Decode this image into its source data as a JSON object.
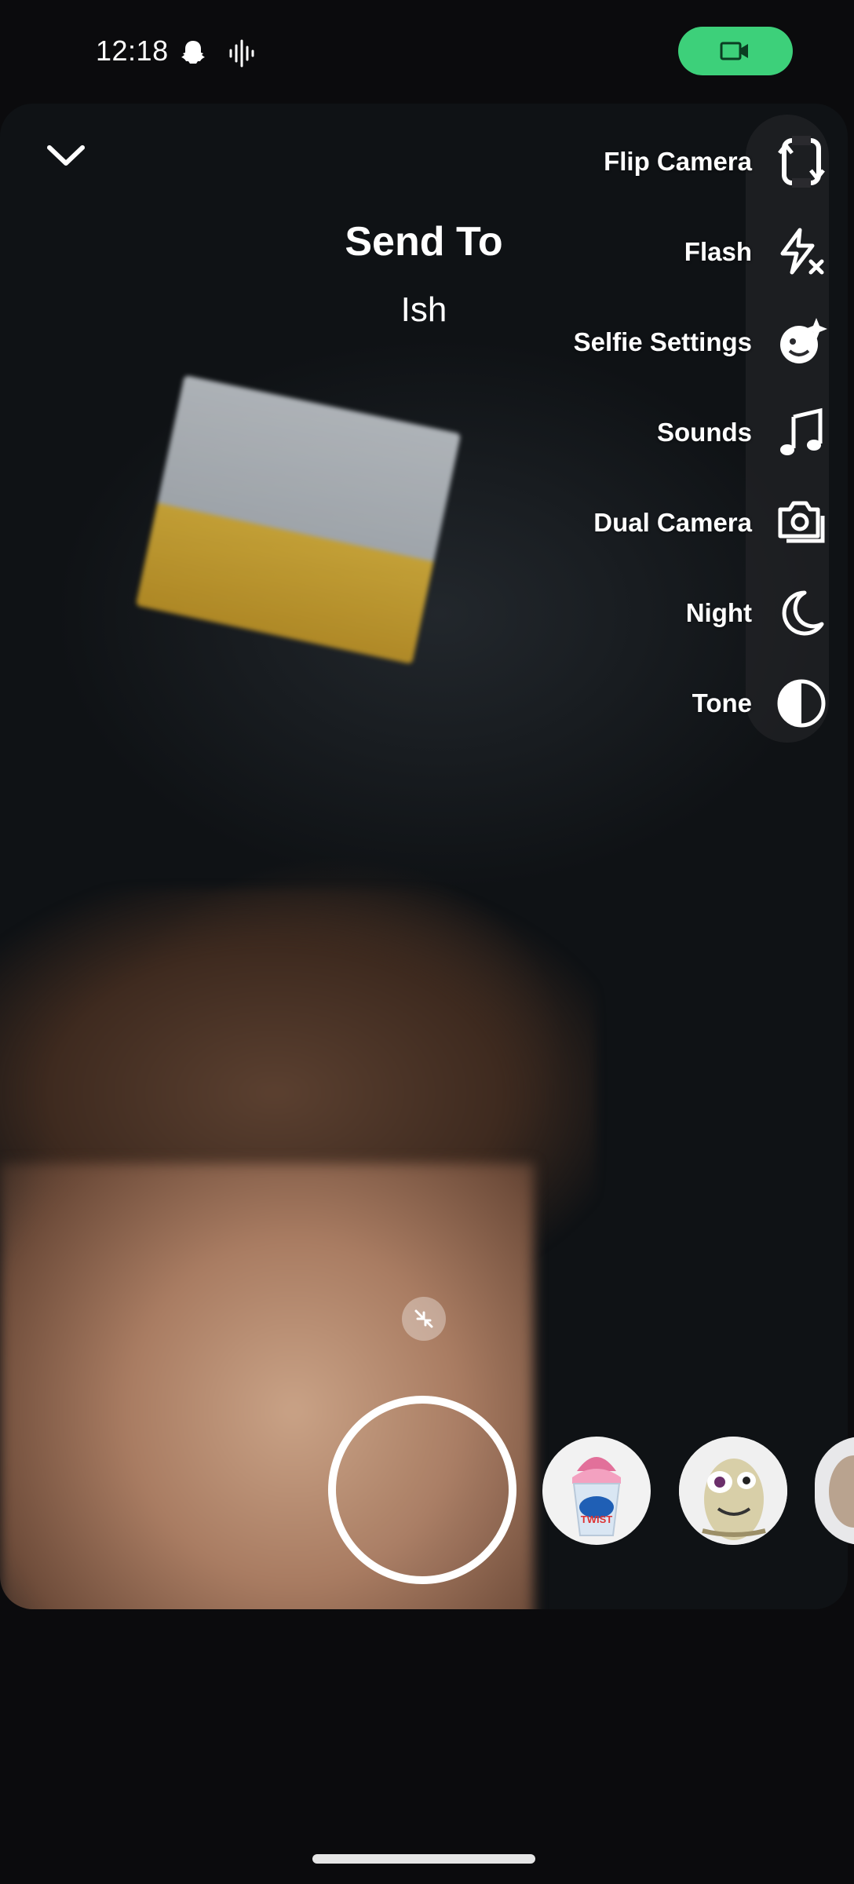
{
  "status_bar": {
    "time": "12:18",
    "icons": [
      "snapchat-ghost-icon",
      "audio-waveform-icon"
    ],
    "recording_indicator": "video-camera-icon"
  },
  "header": {
    "title": "Send To",
    "subtitle": "Ish",
    "collapse_icon": "chevron-down-icon"
  },
  "tools": [
    {
      "label": "Flip Camera",
      "icon": "flip-camera-icon"
    },
    {
      "label": "Flash",
      "icon": "flash-off-icon"
    },
    {
      "label": "Selfie Settings",
      "icon": "selfie-settings-icon"
    },
    {
      "label": "Sounds",
      "icon": "music-note-icon"
    },
    {
      "label": "Dual Camera",
      "icon": "dual-camera-icon"
    },
    {
      "label": "Night",
      "icon": "moon-icon"
    },
    {
      "label": "Tone",
      "icon": "tone-icon"
    }
  ],
  "bottom": {
    "shrink_icon": "shrink-arrows-icon",
    "lenses": [
      {
        "name": "twist-ice-cream-lens",
        "text": "TWIST"
      },
      {
        "name": "sloth-character-lens"
      },
      {
        "name": "partial-lens"
      }
    ]
  },
  "colors": {
    "record_green": "#3dd07a",
    "text": "#ffffff",
    "rail": "#2a2a2e"
  }
}
